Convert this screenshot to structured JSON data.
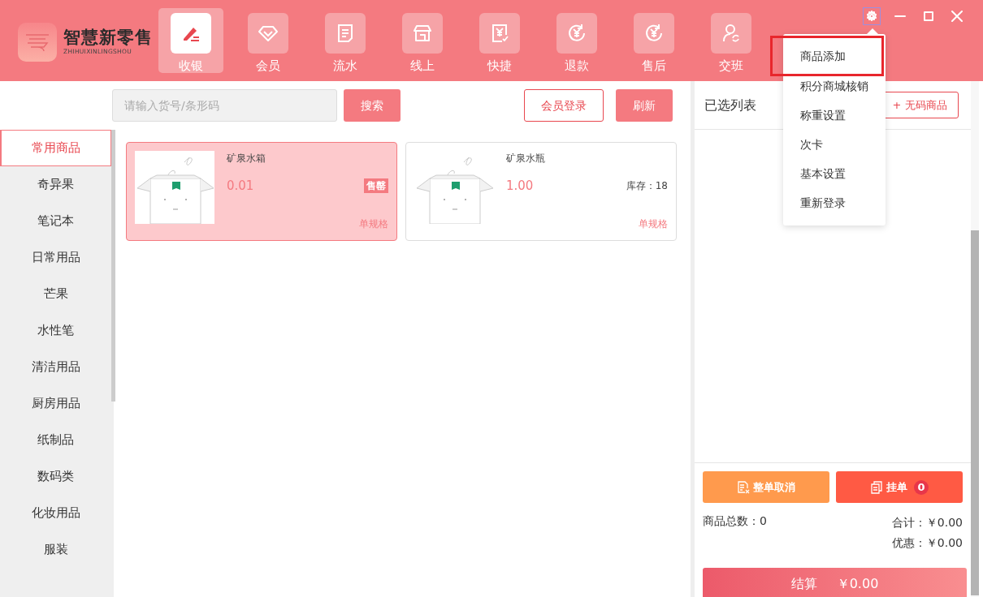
{
  "app": {
    "logo_title": "智慧新零售",
    "logo_subtitle": "ZHIHUIXINLINGSHOU"
  },
  "nav": [
    {
      "label": "收银",
      "selected": true
    },
    {
      "label": "会员",
      "selected": false
    },
    {
      "label": "流水",
      "selected": false
    },
    {
      "label": "线上",
      "selected": false
    },
    {
      "label": "快捷",
      "selected": false
    },
    {
      "label": "退款",
      "selected": false
    },
    {
      "label": "售后",
      "selected": false
    },
    {
      "label": "交班",
      "selected": false
    }
  ],
  "settings_menu": [
    {
      "label": "商品添加",
      "highlighted": true
    },
    {
      "label": "积分商城核销",
      "highlighted": false
    },
    {
      "label": "称重设置",
      "highlighted": false
    },
    {
      "label": "次卡",
      "highlighted": false
    },
    {
      "label": "基本设置",
      "highlighted": false
    },
    {
      "label": "重新登录",
      "highlighted": false
    }
  ],
  "search": {
    "placeholder": "请输入货号/条形码",
    "button": "搜索"
  },
  "member_login": "会员登录",
  "refresh": "刷新",
  "categories": [
    {
      "label": "常用商品",
      "selected": true
    },
    {
      "label": "奇异果",
      "selected": false
    },
    {
      "label": "笔记本",
      "selected": false
    },
    {
      "label": "日常用品",
      "selected": false
    },
    {
      "label": "芒果",
      "selected": false
    },
    {
      "label": "水性笔",
      "selected": false
    },
    {
      "label": "清洁用品",
      "selected": false
    },
    {
      "label": "厨房用品",
      "selected": false
    },
    {
      "label": "纸制品",
      "selected": false
    },
    {
      "label": "数码类",
      "selected": false
    },
    {
      "label": "化妆用品",
      "selected": false
    },
    {
      "label": "服装",
      "selected": false
    }
  ],
  "products": [
    {
      "name": "矿泉水箱",
      "price": "0.01",
      "stock": "售罄",
      "sold_out": true,
      "selected": true,
      "spec": "单规格"
    },
    {
      "name": "矿泉水瓶",
      "price": "1.00",
      "stock": "库存：18",
      "sold_out": false,
      "selected": false,
      "spec": "单规格"
    }
  ],
  "cart": {
    "title": "已选列表",
    "no_code_button": "+ 无码商品",
    "cancel_button": "整单取消",
    "hold_button": "挂单",
    "hold_count": "0",
    "total_count": "商品总数：0",
    "sum": "合计：￥0.00",
    "discount": "优惠：￥0.00",
    "checkout_label": "结算",
    "checkout_amount": "￥0.00"
  }
}
